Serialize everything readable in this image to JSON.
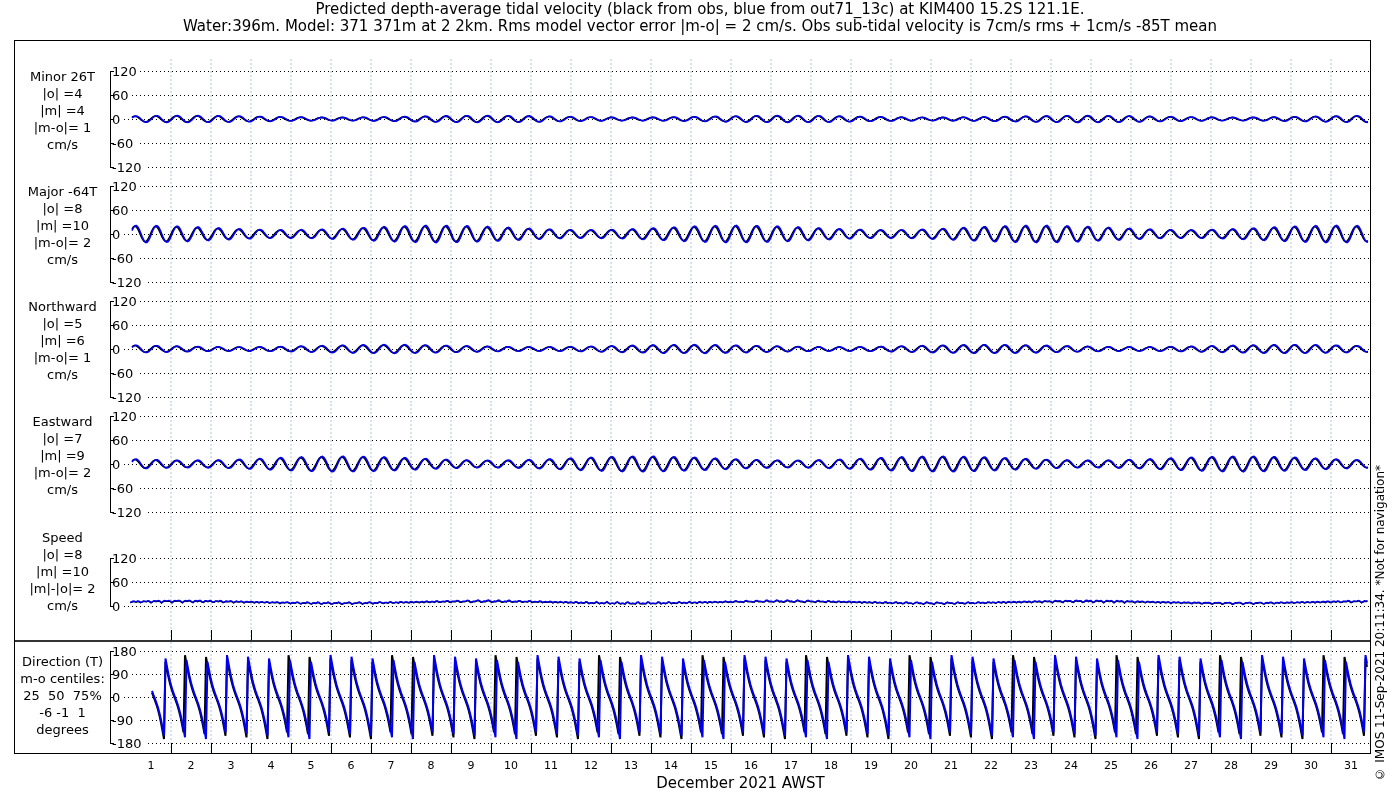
{
  "title": [
    "Predicted depth-average tidal velocity (black from obs, blue from out71_13c) at KIM400 15.2S 121.1E.",
    "Water:396m. Model: 371 371m at 2 2km. Rms model vector error |m-o| = 2 cm/s. Obs sub-tidal velocity is 7cm/s rms + 1cm/s -85T mean"
  ],
  "panels": [
    {
      "kind": "component",
      "label_lines": [
        "Minor 26T",
        "|o| =4",
        "|m| =4",
        "|m-o|= 1",
        "cm/s"
      ],
      "yticks": [
        "120",
        "60",
        "0",
        "-60",
        "-120"
      ]
    },
    {
      "kind": "component",
      "label_lines": [
        "Major -64T",
        "|o| =8",
        "|m| =10",
        "|m-o|= 2",
        "cm/s"
      ],
      "yticks": [
        "120",
        "60",
        "0",
        "-60",
        "-120"
      ]
    },
    {
      "kind": "component",
      "label_lines": [
        "Northward",
        "|o| =5",
        "|m| =6",
        "|m-o|= 1",
        "cm/s"
      ],
      "yticks": [
        "120",
        "60",
        "0",
        "-60",
        "-120"
      ]
    },
    {
      "kind": "component",
      "label_lines": [
        "Eastward",
        "|o| =7",
        "|m| =9",
        "|m-o|= 2",
        "cm/s"
      ],
      "yticks": [
        "120",
        "60",
        "0",
        "-60",
        "-120"
      ]
    },
    {
      "kind": "speed",
      "label_lines": [
        "Speed",
        "|o| =8",
        "|m| =10",
        "|m|-|o|= 2",
        "cm/s"
      ],
      "yticks": [
        "120",
        "60",
        "0"
      ]
    },
    {
      "kind": "direction",
      "label_lines": [
        "Direction (T)",
        "m-o centiles:",
        "25  50  75%",
        "-6 -1  1",
        "degrees"
      ],
      "yticks": [
        "180",
        "90",
        "0",
        "-90",
        "-180"
      ]
    }
  ],
  "x_axis": {
    "day_labels": [
      "1",
      "2",
      "3",
      "4",
      "5",
      "6",
      "7",
      "8",
      "9",
      "10",
      "11",
      "12",
      "13",
      "14",
      "15",
      "16",
      "17",
      "18",
      "19",
      "20",
      "21",
      "22",
      "23",
      "24",
      "25",
      "26",
      "27",
      "28",
      "29",
      "30",
      "31"
    ],
    "xlabel": "December 2021 AWST"
  },
  "credit": "© IMOS 11-Sep-2021 20:11:34. *Not for navigation*"
}
